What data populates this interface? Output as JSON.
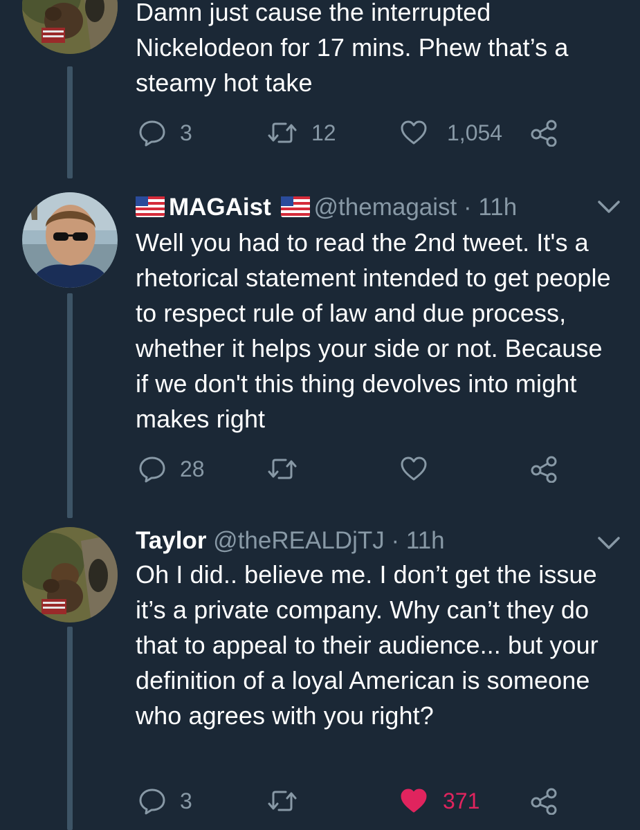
{
  "tweets": [
    {
      "text": "Damn just cause the interrupted Nickelodeon for 17 mins. Phew that’s a steamy hot take",
      "actions": {
        "replies": "3",
        "retweets": "12",
        "likes": "1,054",
        "liked": false
      }
    },
    {
      "display_name": "MAGAist",
      "flag_emoji": "us-flag-icon",
      "handle": "@themagaist",
      "separator": "·",
      "time": "11h",
      "text": "Well you had to read the 2nd tweet. It's a rhetorical statement intended to get people to respect rule of law and due process, whether it helps your side or not. Because if we don't this thing devolves into might makes right",
      "actions": {
        "replies": "28",
        "retweets": "",
        "likes": "",
        "liked": false
      }
    },
    {
      "display_name": "Taylor",
      "handle": "@theREALDjTJ",
      "separator": "·",
      "time": "11h",
      "text": "Oh I did.. believe me. I don’t get the issue it’s a private company. Why can’t they do that to appeal to their audience...  but your definition of a loyal American is someone who agrees with you right?",
      "actions": {
        "replies": "3",
        "retweets": "",
        "likes": "371",
        "liked": true
      }
    }
  ],
  "colors": {
    "background": "#1b2836",
    "secondary_text": "#8899a6",
    "thread_line": "#3d5466",
    "like_active": "#e0245e"
  }
}
